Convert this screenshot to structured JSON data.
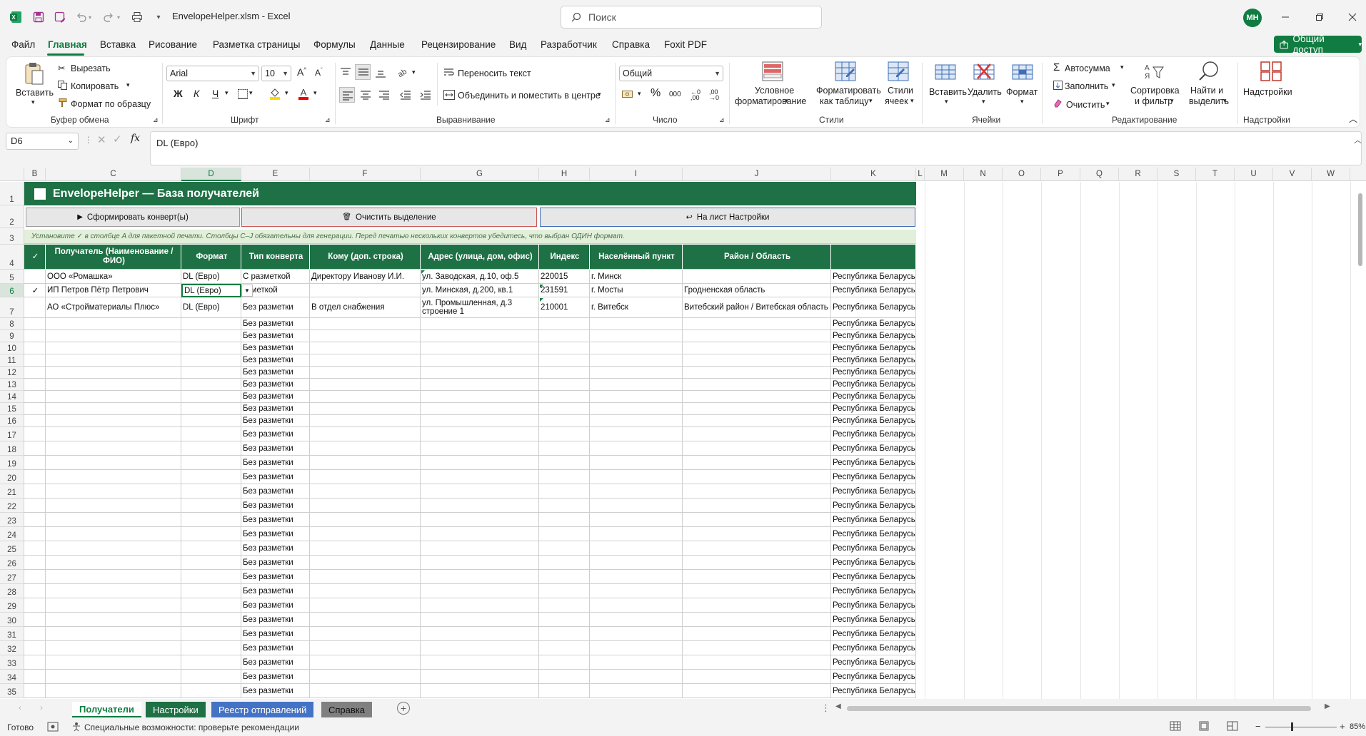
{
  "window": {
    "title": "EnvelopeHelper.xlsm  -  Excel",
    "search_placeholder": "Поиск",
    "user_initials": "МН"
  },
  "tabs": [
    "Файл",
    "Главная",
    "Вставка",
    "Рисование",
    "Разметка страницы",
    "Формулы",
    "Данные",
    "Рецензирование",
    "Вид",
    "Разработчик",
    "Справка",
    "Foxit PDF"
  ],
  "share_label": "Общий доступ",
  "ribbon": {
    "clipboard": {
      "paste": "Вставить",
      "cut": "Вырезать",
      "copy": "Копировать",
      "format_painter": "Формат по образцу",
      "group": "Буфер обмена"
    },
    "font": {
      "name": "Arial",
      "size": "10",
      "bold": "Ж",
      "italic": "К",
      "underline": "Ч",
      "group": "Шрифт"
    },
    "alignment": {
      "wrap": "Переносить текст",
      "merge": "Объединить и поместить в центре",
      "group": "Выравнивание"
    },
    "number": {
      "format": "Общий",
      "group": "Число",
      "thousands": "000"
    },
    "styles": {
      "conditional": [
        "Условное",
        "форматирование"
      ],
      "as_table": [
        "Форматировать",
        "как таблицу"
      ],
      "cell_styles": [
        "Стили",
        "ячеек"
      ],
      "group": "Стили"
    },
    "cells": {
      "insert": "Вставить",
      "delete": "Удалить",
      "format": "Формат",
      "group": "Ячейки"
    },
    "editing": {
      "autosum": "Автосумма",
      "fill": "Заполнить",
      "clear": "Очистить",
      "sort": [
        "Сортировка",
        "и фильтр"
      ],
      "find": [
        "Найти и",
        "выделить"
      ],
      "group": "Редактирование"
    },
    "addins": {
      "label": "Надстройки",
      "group": "Надстройки"
    }
  },
  "formula_bar": {
    "name_box": "D6",
    "formula": "DL (Евро)",
    "fx": "fx"
  },
  "columns": [
    "B",
    "C",
    "D",
    "E",
    "F",
    "G",
    "H",
    "I",
    "J",
    "K",
    "L",
    "M",
    "N",
    "O",
    "P",
    "Q",
    "R",
    "S",
    "T",
    "U",
    "V",
    "W"
  ],
  "sheet": {
    "banner": "EnvelopeHelper  —  База получателей",
    "buttons": {
      "generate": "Сформировать конверт(ы)",
      "clear": "Очистить выделение",
      "settings": "На лист Настройки"
    },
    "hint": "Установите ✓ в столбце A для пакетной печати. Столбцы C–J обязательны для генерации. Перед печатью нескольких конвертов убедитесь, что выбран ОДИН формат.",
    "headers": {
      "check": "✓",
      "recipient": "Получатель (Наименование / ФИО)",
      "format": "Формат",
      "type": "Тип конверта",
      "to_whom": "Кому (доп. строка)",
      "address": "Адрес (улица, дом, офис)",
      "index": "Индекс",
      "city": "Населённый пункт",
      "region": "Район / Область",
      "country": ""
    },
    "rows": [
      {
        "n": "5",
        "check": "",
        "recipient": "ООО «Ромашка»",
        "format": "DL (Евро)",
        "type": "С разметкой",
        "to_whom": "Директору Иванову И.И.",
        "address": "ул. Заводская, д.10, оф.5",
        "index": "220015",
        "city": "г. Минск",
        "region": "",
        "country": "Республика Беларусь"
      },
      {
        "n": "6",
        "check": "✓",
        "recipient": "ИП Петров Пётр Петрович",
        "format": "DL (Евро)",
        "type": "азметкой",
        "to_whom": "",
        "address": "ул. Минская, д.200, кв.1",
        "index": "231591",
        "city": "г. Мосты",
        "region": "Гродненская область",
        "country": "Республика Беларусь"
      },
      {
        "n": "7",
        "check": "",
        "recipient": "АО «Стройматериалы Плюс»",
        "format": "DL (Евро)",
        "type": "Без разметки",
        "to_whom": "В отдел снабжения",
        "address": "ул. Промышленная, д.3 строение 1",
        "index": "210001",
        "city": "г. Витебск",
        "region": "Витебский район / Витебская область",
        "country": "Республика Беларусь"
      }
    ],
    "empty_type": "Без разметки",
    "empty_country": "Республика Беларусь",
    "row_numbers": [
      "1",
      "2",
      "3",
      "4"
    ]
  },
  "sheet_tabs": [
    {
      "label": "Получатели",
      "color": "#ffffff"
    },
    {
      "label": "Настройки",
      "color": "#1e7145"
    },
    {
      "label": "Реестр отправлений",
      "color": "#4472c4"
    },
    {
      "label": "Справка",
      "color": "#808080"
    }
  ],
  "status": {
    "ready": "Готово",
    "accessibility": "Специальные возможности: проверьте рекомендации",
    "zoom": "85%"
  }
}
